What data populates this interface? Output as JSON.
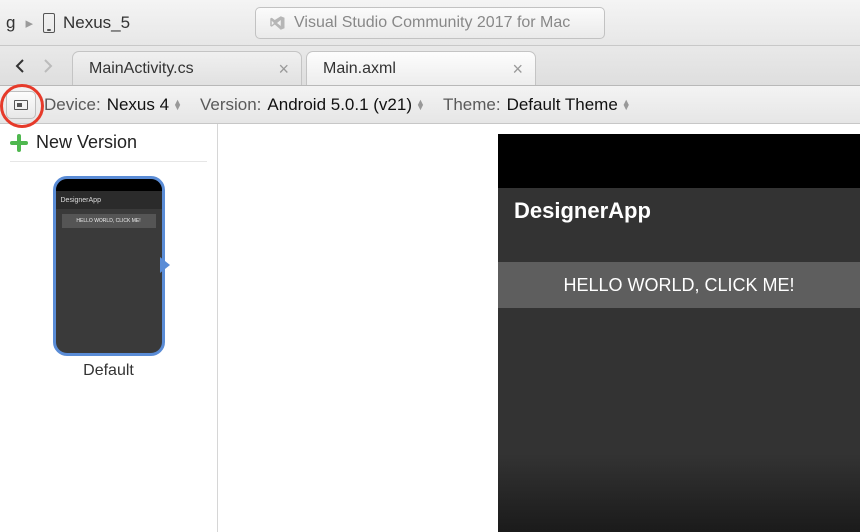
{
  "breadcrumb": {
    "prev_fragment": "g",
    "device_name": "Nexus_5"
  },
  "title_bar": {
    "text": "Visual Studio Community 2017 for Mac"
  },
  "tabs": [
    {
      "label": "MainActivity.cs",
      "active": false
    },
    {
      "label": "Main.axml",
      "active": true
    }
  ],
  "toolbar": {
    "device_label": "Device:",
    "device_value": "Nexus 4",
    "version_label": "Version:",
    "version_value": "Android 5.0.1 (v21)",
    "theme_label": "Theme:",
    "theme_value": "Default Theme"
  },
  "sidebar": {
    "new_version_label": "New Version",
    "thumbnail": {
      "app_title": "DesignerApp",
      "button_text": "HELLO WORLD, CLICK ME!",
      "caption": "Default"
    }
  },
  "preview": {
    "app_title": "DesignerApp",
    "button_text": "HELLO WORLD, CLICK ME!"
  }
}
